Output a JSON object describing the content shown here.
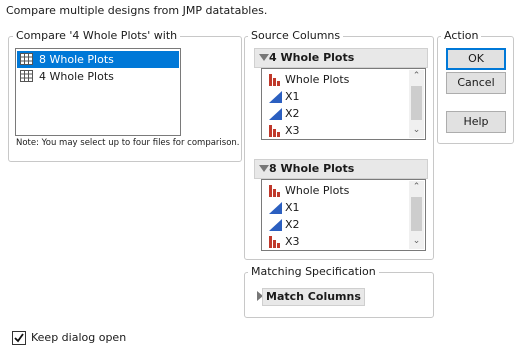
{
  "header": {
    "description": "Compare multiple designs from JMP datatables."
  },
  "compare_group": {
    "legend": "Compare '4 Whole Plots' with",
    "items": [
      {
        "label": "8 Whole Plots",
        "selected": true
      },
      {
        "label": "4 Whole Plots",
        "selected": false
      }
    ],
    "note": "Note: You may select up to four files for comparison."
  },
  "source_columns": {
    "legend": "Source Columns",
    "panels": [
      {
        "title": "4 Whole Plots",
        "columns": [
          {
            "label": "Whole Plots",
            "icon": "nominal-bar-icon"
          },
          {
            "label": "X1",
            "icon": "continuous-triangle-icon"
          },
          {
            "label": "X2",
            "icon": "continuous-triangle-icon"
          },
          {
            "label": "X3",
            "icon": "nominal-bar-icon"
          }
        ]
      },
      {
        "title": "8 Whole Plots",
        "columns": [
          {
            "label": "Whole Plots",
            "icon": "nominal-bar-icon"
          },
          {
            "label": "X1",
            "icon": "continuous-triangle-icon"
          },
          {
            "label": "X2",
            "icon": "continuous-triangle-icon"
          },
          {
            "label": "X3",
            "icon": "nominal-bar-icon"
          }
        ]
      }
    ]
  },
  "matching": {
    "legend": "Matching Specification",
    "button": "Match Columns"
  },
  "action": {
    "legend": "Action",
    "ok": "OK",
    "cancel": "Cancel",
    "help": "Help"
  },
  "keep_open": {
    "label": "Keep dialog open",
    "checked": true
  },
  "colors": {
    "selection": "#0078d7",
    "nominal": "#c0392b",
    "continuous": "#2b5fc0"
  }
}
